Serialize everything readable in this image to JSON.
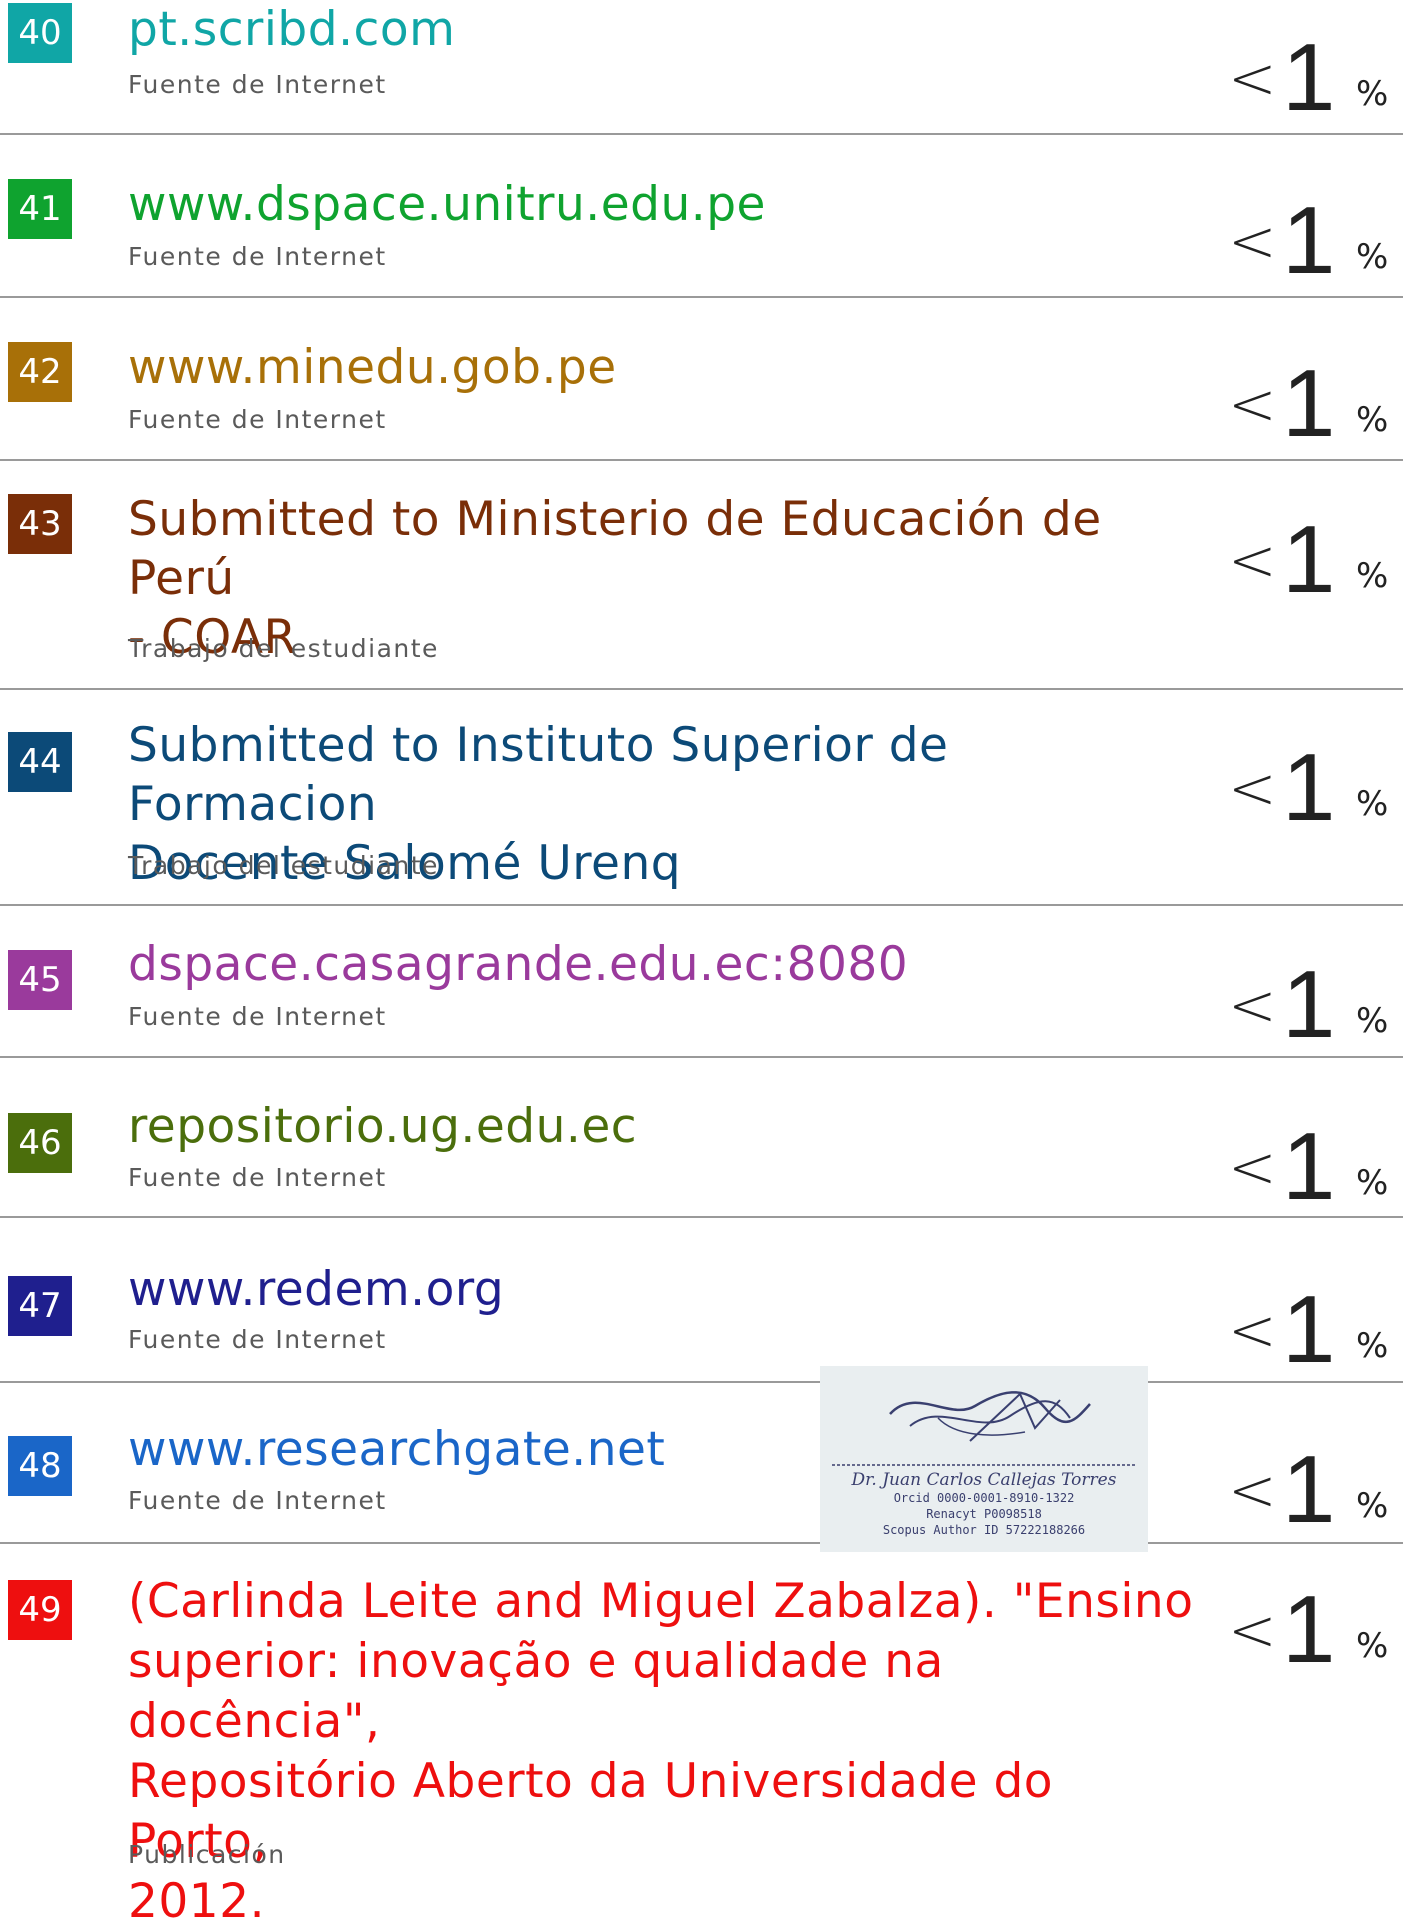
{
  "entries": [
    {
      "number": "40",
      "title_lines": [
        "pt.scribd.com"
      ],
      "kind": "Fuente de Internet",
      "percent_sign": "<",
      "percent_value": "1",
      "percent_unit": "%",
      "color": "#10a6a6"
    },
    {
      "number": "41",
      "title_lines": [
        "www.dspace.unitru.edu.pe"
      ],
      "kind": "Fuente de Internet",
      "percent_sign": "<",
      "percent_value": "1",
      "percent_unit": "%",
      "color": "#0fa32f"
    },
    {
      "number": "42",
      "title_lines": [
        "www.minedu.gob.pe"
      ],
      "kind": "Fuente de Internet",
      "percent_sign": "<",
      "percent_value": "1",
      "percent_unit": "%",
      "color": "#a87008"
    },
    {
      "number": "43",
      "title_lines": [
        "Submitted to Ministerio de Educación de Perú",
        "- COAR"
      ],
      "kind": "Trabajo del estudiante",
      "percent_sign": "<",
      "percent_value": "1",
      "percent_unit": "%",
      "color": "#7a2e08"
    },
    {
      "number": "44",
      "title_lines": [
        "Submitted to Instituto Superior de Formacion",
        "Docente Salomé Urenq"
      ],
      "kind": "Trabajo del estudiante",
      "percent_sign": "<",
      "percent_value": "1",
      "percent_unit": "%",
      "color": "#0c4a78"
    },
    {
      "number": "45",
      "title_lines": [
        "dspace.casagrande.edu.ec:8080"
      ],
      "kind": "Fuente de Internet",
      "percent_sign": "<",
      "percent_value": "1",
      "percent_unit": "%",
      "color": "#9a3a9c"
    },
    {
      "number": "46",
      "title_lines": [
        "repositorio.ug.edu.ec"
      ],
      "kind": "Fuente de Internet",
      "percent_sign": "<",
      "percent_value": "1",
      "percent_unit": "%",
      "color": "#4b6e0c"
    },
    {
      "number": "47",
      "title_lines": [
        "www.redem.org"
      ],
      "kind": "Fuente de Internet",
      "percent_sign": "<",
      "percent_value": "1",
      "percent_unit": "%",
      "color": "#1f1f8e"
    },
    {
      "number": "48",
      "title_lines": [
        "www.researchgate.net"
      ],
      "kind": "Fuente de Internet",
      "percent_sign": "<",
      "percent_value": "1",
      "percent_unit": "%",
      "color": "#1a66c8"
    },
    {
      "number": "49",
      "title_lines": [
        "(Carlinda Leite and Miguel Zabalza). \"Ensino",
        "superior: inovação e qualidade na docência\",",
        "Repositório Aberto da Universidade do Porto,",
        "2012."
      ],
      "kind": "Publicación",
      "percent_sign": "<",
      "percent_value": "1",
      "percent_unit": "%",
      "color": "#ee0f0f"
    }
  ],
  "stamp": {
    "name": "Dr. Juan Carlos Callejas Torres",
    "orcid": "Orcid 0000-0001-8910-1322",
    "renacyt": "Renacyt P0098518",
    "scopus": "Scopus Author ID 57222188266"
  }
}
